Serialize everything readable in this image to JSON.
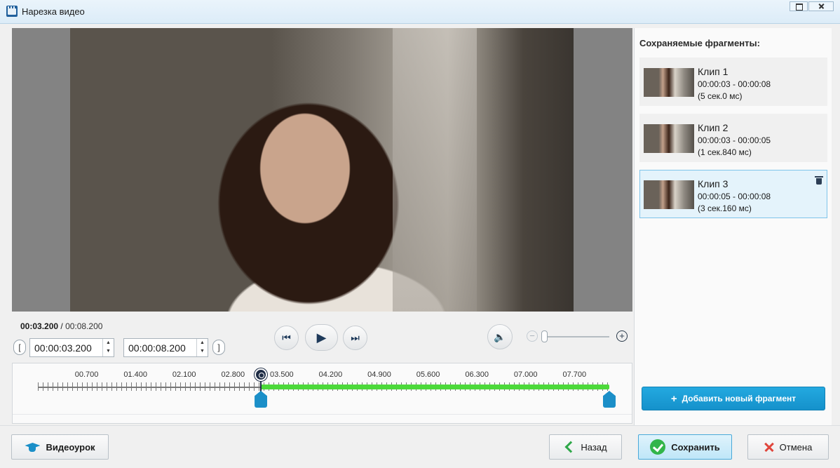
{
  "window": {
    "title": "Нарезка видео",
    "icons": {
      "app": "clapperboard-icon",
      "maximize": "maximize-icon",
      "close": "close-icon"
    }
  },
  "player": {
    "current_time": "00:03.200",
    "separator": " / ",
    "total_time": "00:08.200",
    "start_bracket": "[",
    "end_bracket": "]",
    "start_value": "00:00:03.200",
    "end_value": "00:00:08.200",
    "icons": {
      "prev": "previous-frame-icon",
      "play": "play-icon",
      "next": "next-frame-icon",
      "volume": "volume-icon"
    },
    "zoom_minus": "⊖",
    "zoom_plus": "⊕"
  },
  "timeline": {
    "ticks": [
      "00.700",
      "01.400",
      "02.100",
      "02.800",
      "03.500",
      "04.200",
      "04.900",
      "05.600",
      "06.300",
      "07.000",
      "07.700"
    ],
    "duration_seconds": 8.2,
    "playhead_seconds": 3.2,
    "selection_start_seconds": 3.2,
    "selection_end_seconds": 8.2
  },
  "fragments": {
    "title": "Сохраняемые фрагменты:",
    "items": [
      {
        "name": "Клип 1",
        "range": "00:00:03 - 00:00:08",
        "duration": "(5 сек.0 мс)",
        "selected": false
      },
      {
        "name": "Клип 2",
        "range": "00:00:03 - 00:00:05",
        "duration": "(1 сек.840 мс)",
        "selected": false
      },
      {
        "name": "Клип 3",
        "range": "00:00:05 - 00:00:08",
        "duration": "(3 сек.160 мс)",
        "selected": true
      }
    ],
    "add_label": "Добавить новый фрагмент"
  },
  "buttons": {
    "lesson": "Видеоурок",
    "back": "Назад",
    "save": "Сохранить",
    "cancel": "Отмена"
  },
  "colors": {
    "accent": "#1b8fc8",
    "selection": "#4cd93a",
    "playhead": "#1f2d46"
  }
}
